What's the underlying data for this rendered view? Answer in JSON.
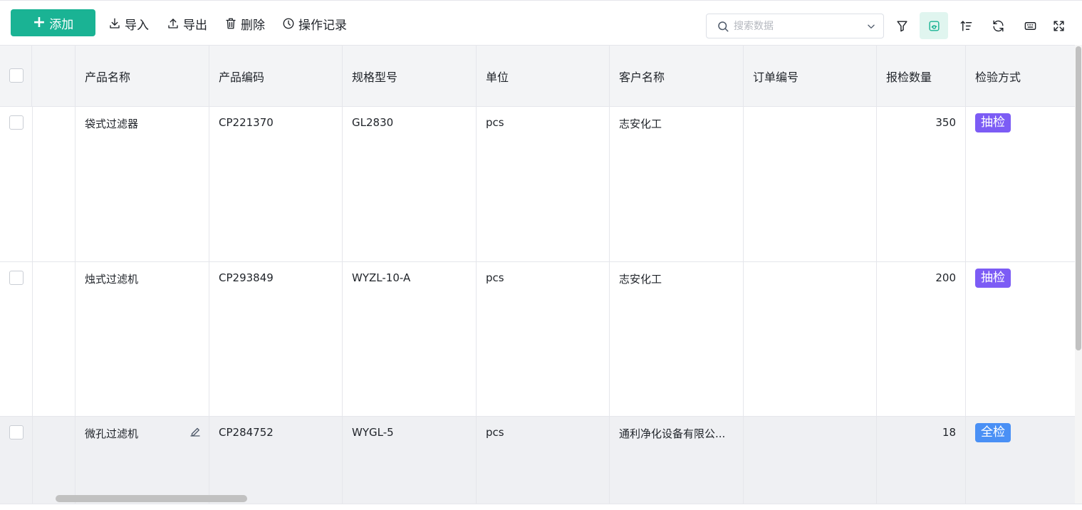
{
  "toolbar": {
    "add_label": "添加",
    "import_label": "导入",
    "export_label": "导出",
    "delete_label": "删除",
    "history_label": "操作记录"
  },
  "search": {
    "placeholder": "搜索数据",
    "value": ""
  },
  "icons": {
    "filter": "filter-icon",
    "view": "card-view-icon",
    "sort": "sort-icon",
    "refresh": "refresh-icon",
    "keyboard": "keyboard-icon",
    "fullscreen": "fullscreen-icon"
  },
  "colors": {
    "accent": "#1ab394",
    "tag_sample": "#7c5cf5",
    "tag_full": "#4a90f5"
  },
  "table": {
    "columns": [
      "产品名称",
      "产品编码",
      "规格型号",
      "单位",
      "客户名称",
      "订单编号",
      "报检数量",
      "检验方式"
    ],
    "rows": [
      {
        "name": "袋式过滤器",
        "code": "CP221370",
        "spec": "GL2830",
        "unit": "pcs",
        "customer": "志安化工",
        "order": "",
        "qty": "350",
        "method": "抽检"
      },
      {
        "name": "烛式过滤机",
        "code": "CP293849",
        "spec": "WYZL-10-A",
        "unit": "pcs",
        "customer": "志安化工",
        "order": "",
        "qty": "200",
        "method": "抽检"
      },
      {
        "name": "微孔过滤机",
        "code": "CP284752",
        "spec": "WYGL-5",
        "unit": "pcs",
        "customer": "通利净化设备有限公...",
        "order": "",
        "qty": "18",
        "method": "全检"
      }
    ]
  }
}
